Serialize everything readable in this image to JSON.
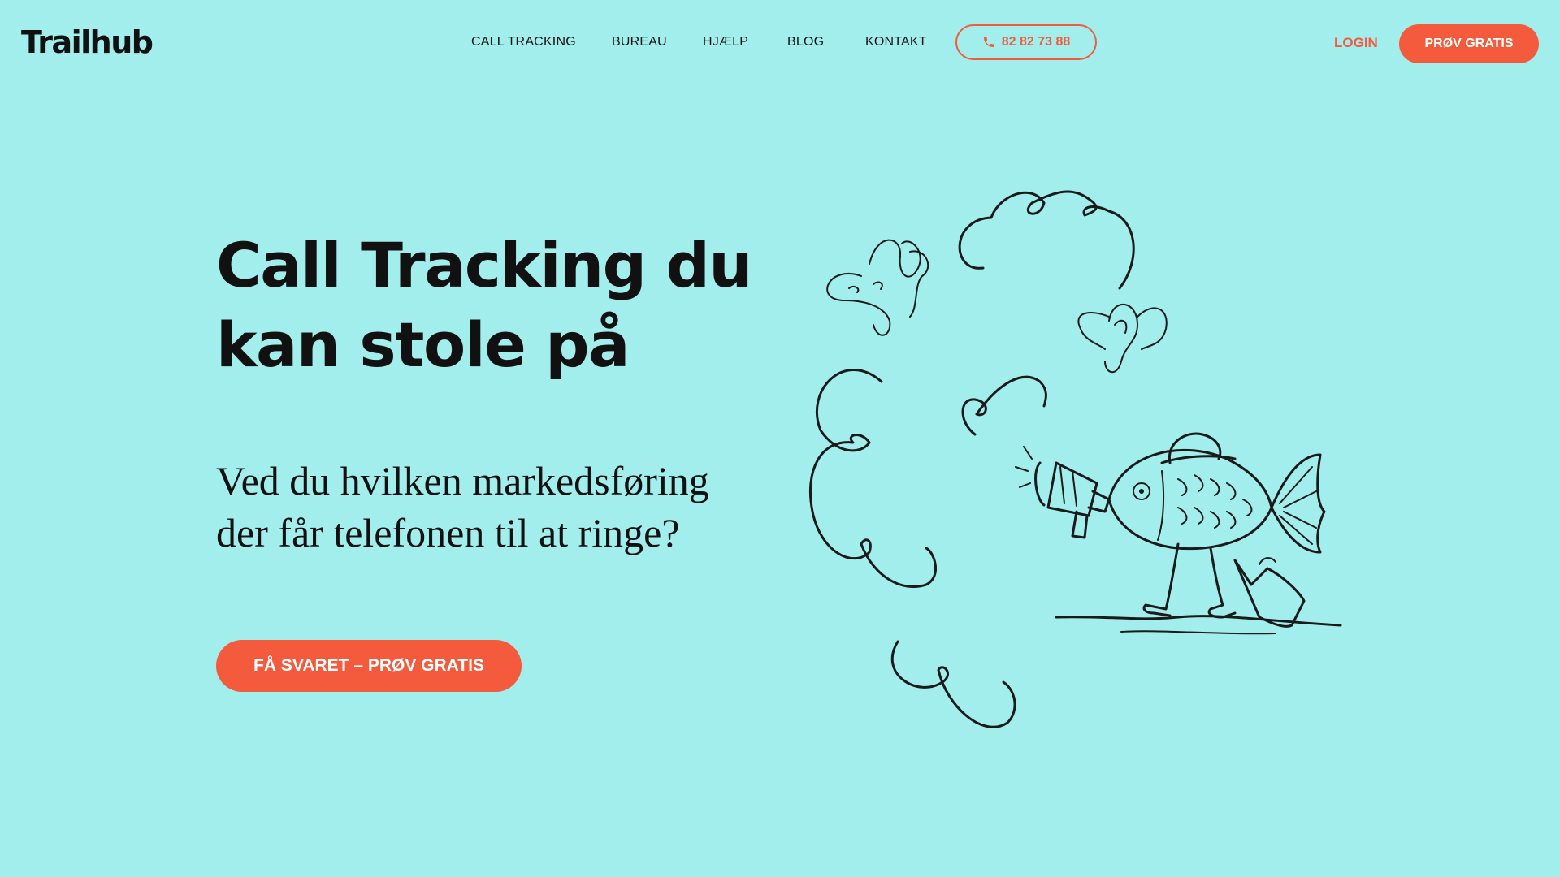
{
  "header": {
    "logo": "Trailhub",
    "nav": [
      {
        "label": "CALL TRACKING"
      },
      {
        "label": "BUREAU"
      },
      {
        "label": "HJÆLP"
      },
      {
        "label": "BLOG"
      },
      {
        "label": "KONTAKT"
      }
    ],
    "phone": "82 82 73 88",
    "login": "LOGIN",
    "try_free": "PRØV GRATIS"
  },
  "hero": {
    "title_line1": "Call Tracking du",
    "title_line2": "kan stole på",
    "subtitle_line1": "Ved du hvilken markedsføring",
    "subtitle_line2": "der får telefonen til at ringe?",
    "cta": "FÅ SVARET – PRØV GRATIS"
  },
  "illustration": {
    "subject": "fish-with-megaphone-icon"
  },
  "colors": {
    "background": "#a2eeec",
    "accent": "#f45a3c",
    "text": "#111111"
  }
}
